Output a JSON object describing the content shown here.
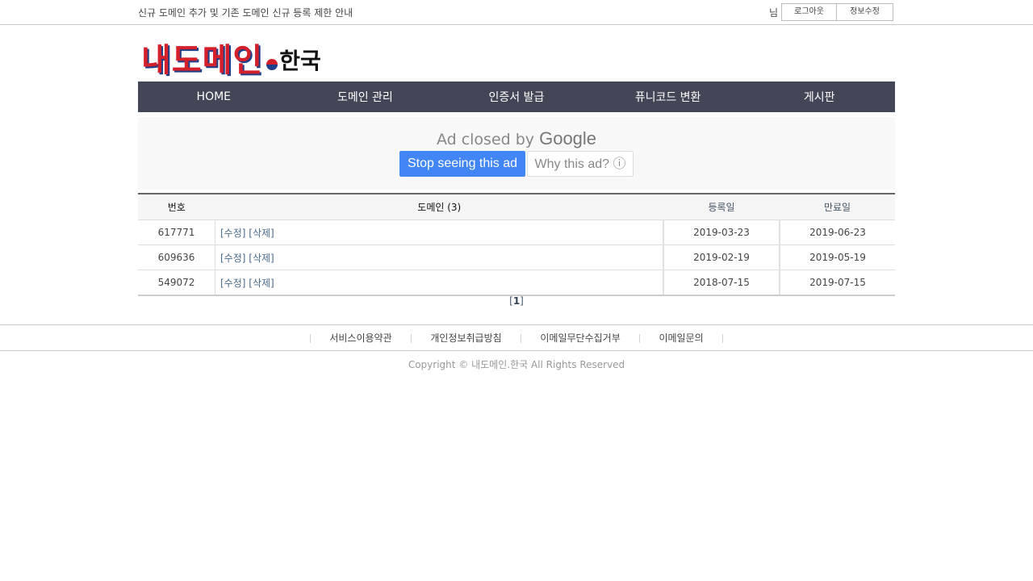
{
  "topbar": {
    "notice": "신규 도메인 추가 및 기존 도메인 신규 등록 제한 안내",
    "user_suffix": "님",
    "logout_label": "로그아웃",
    "edit_label": "정보수정"
  },
  "logo": {
    "main": "내도메인",
    "tld": "한국"
  },
  "nav": [
    "HOME",
    "도메인 관리",
    "인증서 발급",
    "퓨니코드 변환",
    "게시판"
  ],
  "ad": {
    "closed_text": "Ad closed by",
    "brand": "Google",
    "stop_label": "Stop seeing this ad",
    "why_label": "Why this ad? ⓘ"
  },
  "table": {
    "headers": {
      "num": "번호",
      "domain": "도메인 (3)",
      "registered": "등록일",
      "expires": "만료일"
    },
    "edit_label": "[수정]",
    "delete_label": "[삭제]",
    "rows": [
      {
        "num": "617771",
        "registered": "2019-03-23",
        "expires": "2019-06-23",
        "expired": false
      },
      {
        "num": "609636",
        "registered": "2019-02-19",
        "expires": "2019-05-19",
        "expired": true
      },
      {
        "num": "549072",
        "registered": "2018-07-15",
        "expires": "2019-07-15",
        "expired": false
      }
    ]
  },
  "pager": {
    "open": "[",
    "page": "1",
    "close": "]"
  },
  "footer": {
    "links": [
      "서비스이용약관",
      "개인정보취급방침",
      "이메일무단수집거부",
      "이메일문의"
    ],
    "separator": "|",
    "copyright": "Copyright © 내도메인.한국 All Rights Reserved"
  },
  "colors": {
    "nav_bg": "#434657",
    "expired": "#e00000",
    "ad_button": "#4285f4"
  }
}
